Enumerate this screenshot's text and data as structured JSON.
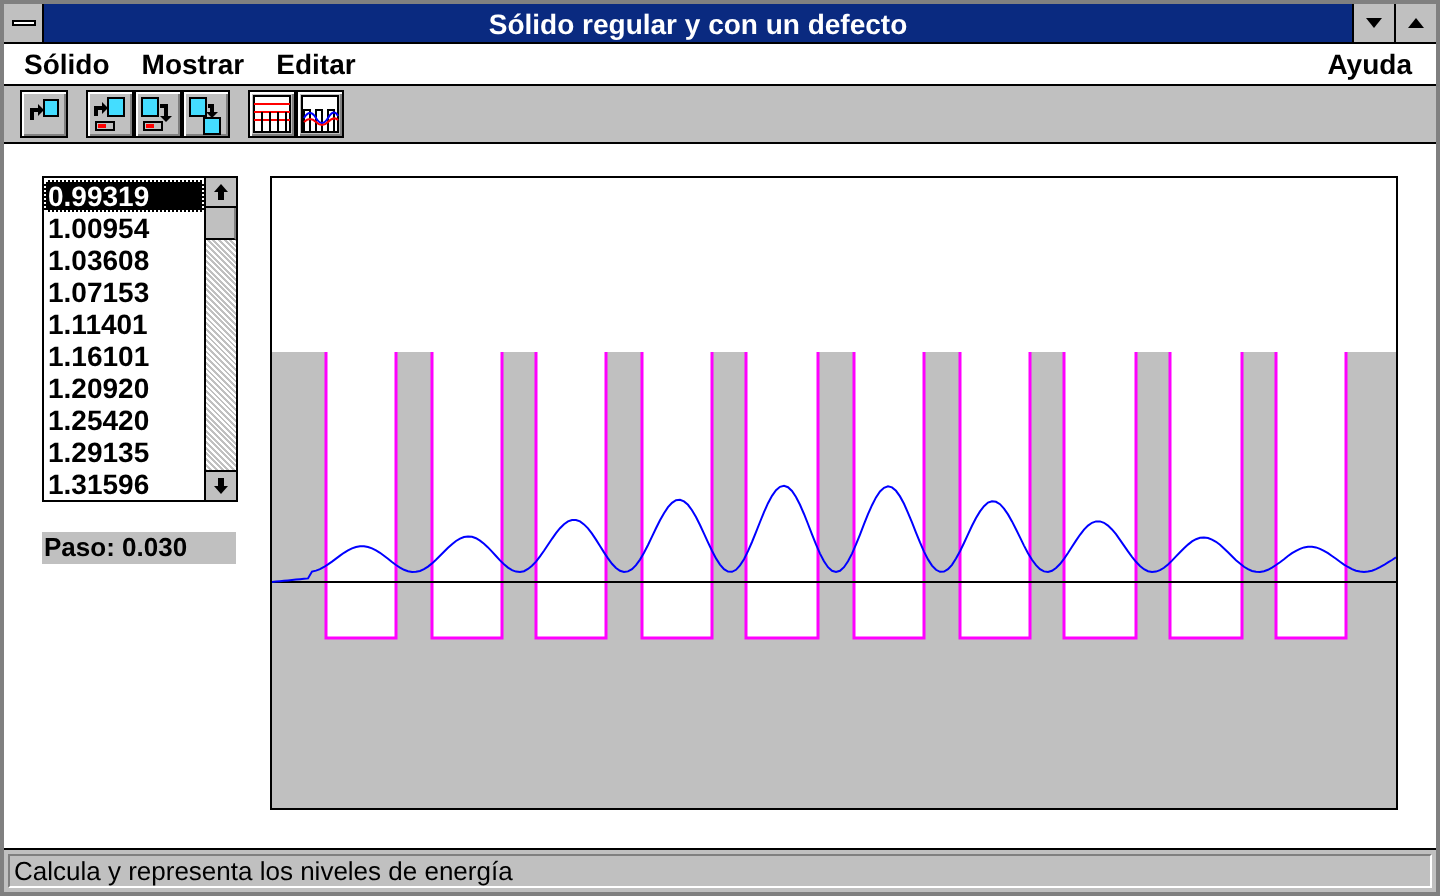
{
  "window": {
    "title": "Sólido regular y con un defecto"
  },
  "menu": [
    {
      "label": "Sólido"
    },
    {
      "label": "Mostrar"
    },
    {
      "label": "Editar"
    }
  ],
  "help_menu": {
    "label": "Ayuda"
  },
  "energy_list": [
    {
      "value": "0.99319",
      "selected": true
    },
    {
      "value": "1.00954",
      "selected": false
    },
    {
      "value": "1.03608",
      "selected": false
    },
    {
      "value": "1.07153",
      "selected": false
    },
    {
      "value": "1.11401",
      "selected": false
    },
    {
      "value": "1.16101",
      "selected": false
    },
    {
      "value": "1.20920",
      "selected": false
    },
    {
      "value": "1.25420",
      "selected": false
    },
    {
      "value": "1.29135",
      "selected": false
    },
    {
      "value": "1.31596",
      "selected": false
    }
  ],
  "step_label": "Paso: 0.030",
  "status_bar": "Calcula y representa los niveles de energía"
}
